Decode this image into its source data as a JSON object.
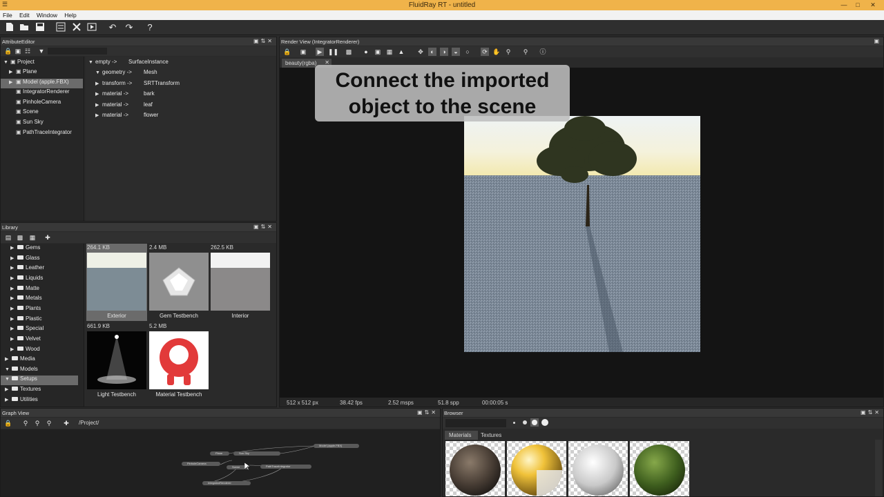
{
  "window": {
    "title": "FluidRay RT - untitled",
    "minimize": "—",
    "maximize": "□",
    "close": "✕"
  },
  "menu": [
    "File",
    "Edit",
    "Window",
    "Help"
  ],
  "main_toolbar": {
    "icons": [
      "new-file-icon",
      "open-folder-icon",
      "save-icon",
      "render-settings-icon",
      "tools-icon",
      "render-icon",
      "undo-icon",
      "redo-icon",
      "help-icon"
    ],
    "help_glyph": "?"
  },
  "attribute_editor": {
    "title": "AttributeEditor",
    "project_label": "Project",
    "tree": [
      {
        "label": "Plane",
        "expandable": true
      },
      {
        "label": "Model (apple.FBX)",
        "expandable": true,
        "selected": true
      },
      {
        "label": "IntegratorRenderer",
        "expandable": false
      },
      {
        "label": "PinholeCamera",
        "expandable": false
      },
      {
        "label": "Scene",
        "expandable": false
      },
      {
        "label": "Sun Sky",
        "expandable": false
      },
      {
        "label": "PathTraceIntegrator",
        "expandable": false
      }
    ],
    "attributes": [
      {
        "key": "empty ->",
        "value": "SurfaceInstance",
        "level": 0
      },
      {
        "key": "geometry ->",
        "value": "Mesh",
        "level": 1
      },
      {
        "key": "transform ->",
        "value": "SRTTransform",
        "level": 1
      },
      {
        "key": "material ->",
        "value": "bark",
        "level": 1
      },
      {
        "key": "material ->",
        "value": "leaf",
        "level": 1
      },
      {
        "key": "material ->",
        "value": "flower",
        "level": 1
      }
    ]
  },
  "library": {
    "title": "Library",
    "folders": [
      {
        "label": "Gems",
        "level": 1
      },
      {
        "label": "Glass",
        "level": 1
      },
      {
        "label": "Leather",
        "level": 1
      },
      {
        "label": "Liquids",
        "level": 1
      },
      {
        "label": "Matte",
        "level": 1
      },
      {
        "label": "Metals",
        "level": 1
      },
      {
        "label": "Plants",
        "level": 1
      },
      {
        "label": "Plastic",
        "level": 1
      },
      {
        "label": "Special",
        "level": 1
      },
      {
        "label": "Velvet",
        "level": 1
      },
      {
        "label": "Wood",
        "level": 1
      },
      {
        "label": "Media",
        "level": 0
      },
      {
        "label": "Models",
        "level": 0
      },
      {
        "label": "Setups",
        "level": 0,
        "selected": true
      },
      {
        "label": "Textures",
        "level": 0
      },
      {
        "label": "Utilities",
        "level": 0
      }
    ],
    "items": [
      {
        "size": "264.1 KB",
        "label": "Exterior"
      },
      {
        "size": "2.4 MB",
        "label": "Gem Testbench"
      },
      {
        "size": "262.5 KB",
        "label": "Interior"
      },
      {
        "size": "661.9 KB",
        "label": "Light Testbench"
      },
      {
        "size": "5.2 MB",
        "label": "Material Testbench"
      }
    ]
  },
  "render_view": {
    "title": "Render View (IntegratorRenderer)",
    "tab": "beauty(rgba)",
    "caption_line1": "Connect the imported",
    "caption_line2": "object to the scene",
    "status": {
      "resolution": "512 x 512 px",
      "fps": "38.42 fps",
      "msps": "2.52 msps",
      "spp": "51.8 spp",
      "time": "00:00:05 s"
    }
  },
  "graph_view": {
    "title": "Graph View",
    "path": "/Project/",
    "nodes": [
      "Plane",
      "Sun Sky",
      "Model (apple.FBX)",
      "PinholeCamera",
      "Scene",
      "PathTraceIntegrator",
      "IntegratorRenderer"
    ]
  },
  "browser": {
    "title": "Browser",
    "tabs": [
      "Materials",
      "Textures"
    ],
    "active_tab": "Materials",
    "swatches": [
      "dark-rock",
      "yellow-white",
      "white",
      "green"
    ]
  },
  "colors": {
    "titlebar": "#f0b34a",
    "panel": "#2a2a2a",
    "selection": "#6b6b6b"
  }
}
